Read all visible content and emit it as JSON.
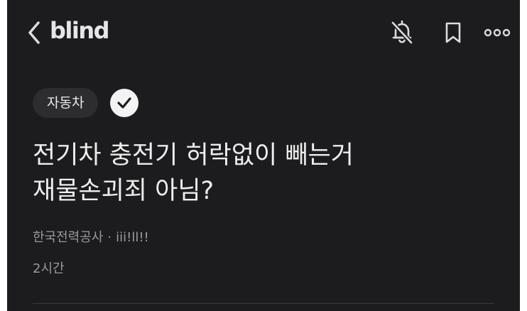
{
  "header": {
    "back_icon": "chevron-left-icon",
    "brand": "blind",
    "actions": [
      {
        "icon": "bell-off-icon"
      },
      {
        "icon": "bookmark-icon"
      },
      {
        "icon": "more-dots-icon"
      }
    ]
  },
  "post": {
    "category": "자동차",
    "verified_icon": "check-circle-icon",
    "title_line1": "전기차 충전기 허락없이 빼는거",
    "title_line2": "재물손괴죄 아님?",
    "company": "한국전력공사",
    "separator": "·",
    "author": "iii!ll!!",
    "time": "2시간"
  },
  "colors": {
    "background": "#1c1c1e",
    "text_primary": "#ededed",
    "text_secondary": "#9a9a9a",
    "tag_bg": "#2d2d30"
  }
}
